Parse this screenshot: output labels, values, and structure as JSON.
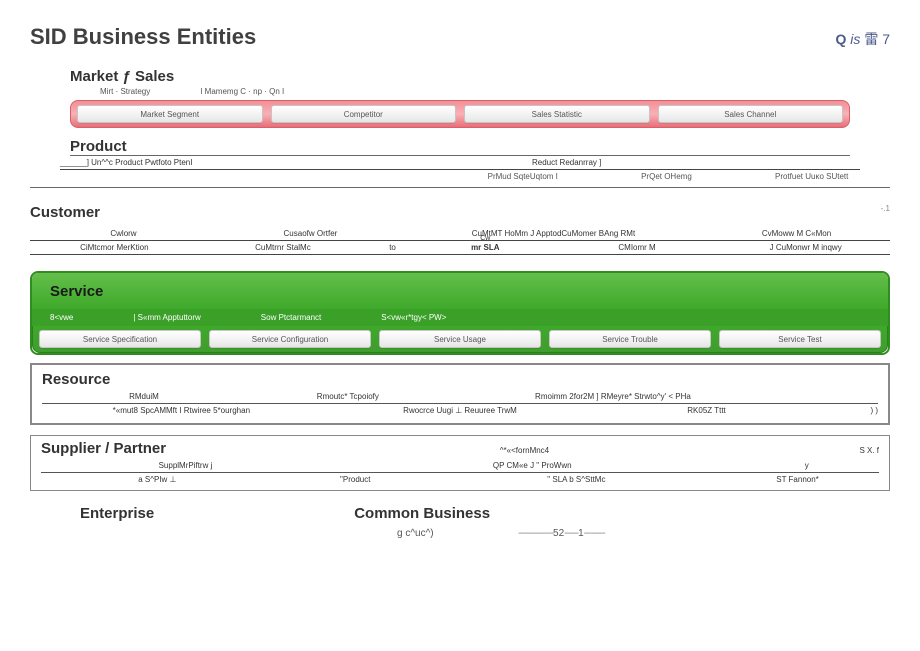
{
  "header": {
    "title": "SID Business Entities",
    "qlabel": "Q",
    "is": "is",
    "suffix": "雷 7"
  },
  "market": {
    "heading": "Market ƒ Sales",
    "sub_left": "Mirt ·  Strategy",
    "sub_right": "I Mamemg C · np · Qn I",
    "chips": [
      "Market Segment",
      "Competitor",
      "Sales Statistic",
      "Sales Channel"
    ]
  },
  "product": {
    "heading": "Product",
    "row1_left": "______] Un^^c Product Pwtfoto PtenI",
    "row1_right": "Reduct Redanrray ]",
    "row2": [
      "PrMud SqteUqtom I",
      "PrQet OHemg",
      "Protfuet Uuκo SUtett"
    ]
  },
  "customer": {
    "heading": "Customer",
    "marker": "-.1",
    "row1": [
      "Cwlorw",
      "Cusaofw Ortfer",
      "CuMtMT HoMm J ApptodCuMomer BAng RMt",
      "CvMoww M C«Mon"
    ],
    "row2_left": "CiMtcmor MerKtion",
    "row2_b": "CuMtrnr StalMc",
    "row2_c": "to",
    "row2_mid_top": "Cw",
    "row2_mid": "mr SLA",
    "row2_d": "CMIomr M",
    "row2_e": "J CuMonwr M inqwy"
  },
  "service": {
    "heading": "Service",
    "mid": [
      "8<vwe",
      "|        S«mm Apptuttorw",
      "Sow Ptctarmanct",
      "S<vw«r*tgy< PW>"
    ],
    "chips": [
      "Service Specification",
      "Service Configuration",
      "Service Usage",
      "Service Trouble",
      "Service Test"
    ]
  },
  "resource": {
    "heading": "Resource",
    "row1": [
      "RMduiM",
      "Rmoutc* Tcpoiofy",
      "Rmoimm 2for2M ] RMeyre* Strwto^y' < PHa",
      ""
    ],
    "row2": [
      "*«mut8 SpcAMMft  I  Rtwiree 5*ourghan",
      "Rwocrce Uugi     ⊥      Reuuree TrwM",
      "RK05Z Tttt",
      ") )"
    ]
  },
  "supplier": {
    "heading": "Supplier / Partner",
    "right1": "^*«<fornMnc4",
    "right2": "S  X.           f",
    "row1": [
      "SupplMrPiftrw         j",
      "QP CM«e         J        \" ProWwn",
      "y"
    ],
    "row2": [
      "a       S^PIw         ⊥",
      "\"Product",
      "\" SLA         b        S^SttMc",
      "ST Fannon*"
    ]
  },
  "bottom": {
    "enterprise": "Enterprise",
    "common": "Common Business"
  },
  "footer": {
    "left": "g c^uc^)",
    "page_a": "52",
    "page_b": "1"
  }
}
